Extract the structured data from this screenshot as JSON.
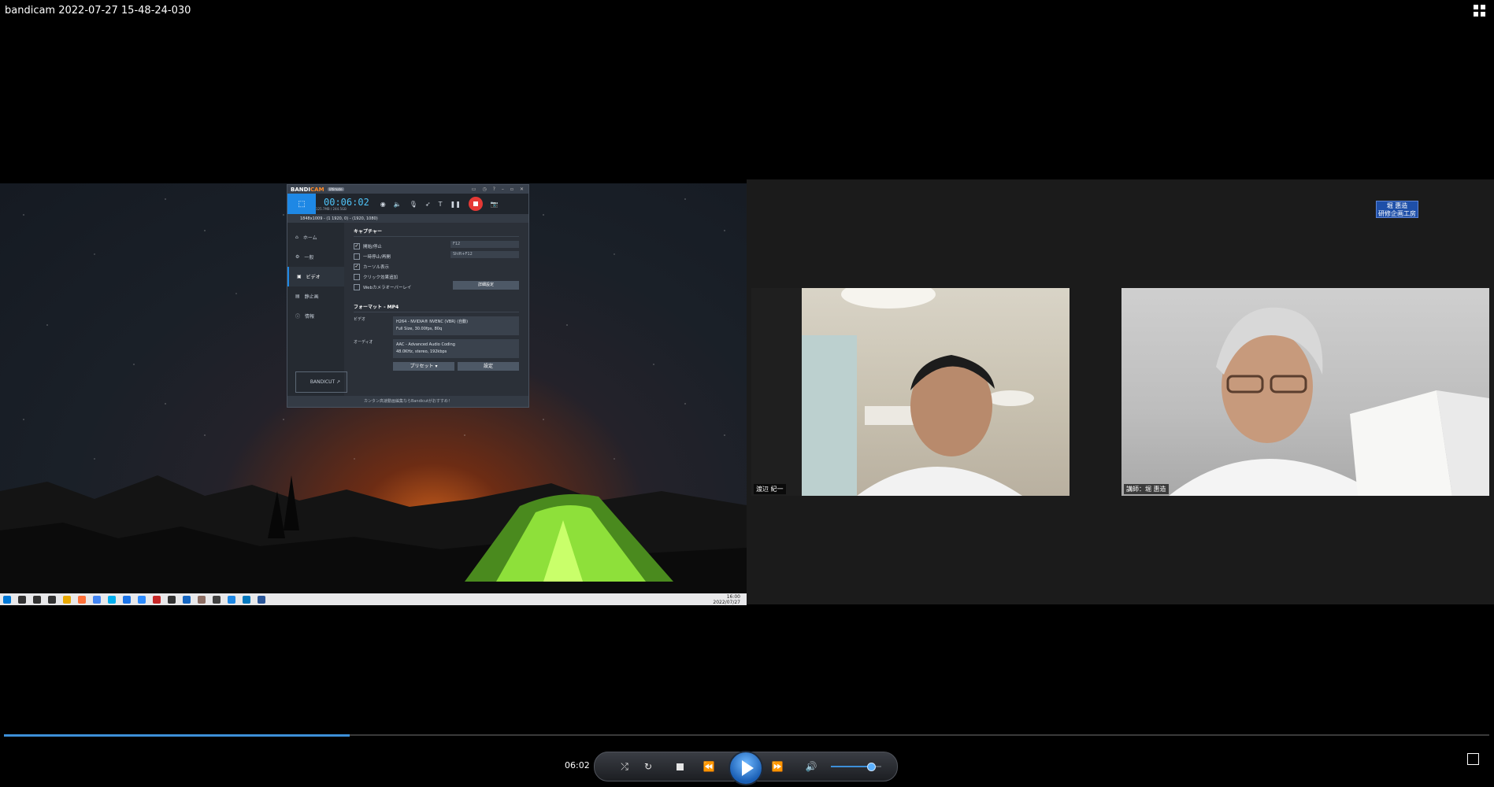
{
  "window": {
    "title": "bandicam 2022-07-27 15-48-24-030",
    "corner_icon": "switch-to-library-icon"
  },
  "desktop": {
    "taskbar_icons": [
      "windows-start",
      "search",
      "cortana",
      "task-view",
      "file-explorer",
      "firefox",
      "chrome",
      "skype",
      "edge",
      "zoom",
      "app",
      "media",
      "app",
      "app",
      "app",
      "app",
      "app",
      "word"
    ],
    "taskbar_icon_colors": [
      "#0078d7",
      "#333333",
      "#333333",
      "#333333",
      "#e8a800",
      "#ff7139",
      "#4285f4",
      "#00aff0",
      "#1a73e8",
      "#2d8cff",
      "#c62828",
      "#333333",
      "#1565c0",
      "#8d6e63",
      "#424242",
      "#1e88e5",
      "#0277bd",
      "#2b579a"
    ],
    "clock_time": "16:00",
    "clock_date": "2022/07/27"
  },
  "bandicam": {
    "logo_prefix": "BANDI",
    "logo_suffix": "CAM",
    "badge": "Ultimate",
    "timer": "00:06:02",
    "file_size": "125.7MB / 244.5GB",
    "target": "1848x1009 - (1 1920, 0) - (1920, 1080)",
    "sidebar": [
      {
        "label": "ホーム",
        "icon": "home-icon"
      },
      {
        "label": "一般",
        "icon": "gear-icon"
      },
      {
        "label": "ビデオ",
        "icon": "video-icon",
        "active": true
      },
      {
        "label": "静止画",
        "icon": "image-icon"
      },
      {
        "label": "情報",
        "icon": "info-icon"
      }
    ],
    "bandicut_label": "BANDICUT ↗",
    "capture_heading": "キャプチャー",
    "options": [
      {
        "label": "開始/停止",
        "checked": true
      },
      {
        "label": "一時停止/再開",
        "checked": false
      },
      {
        "label": "カーソル表示",
        "checked": true
      },
      {
        "label": "クリック効果追加",
        "checked": false
      },
      {
        "label": "Webカメラオーバーレイ",
        "checked": false
      }
    ],
    "hotkey_1": "F12",
    "hotkey_2": "Shift+F12",
    "advanced_button": "詳細設定",
    "format_heading": "フォーマット - MP4",
    "video_label": "ビデオ",
    "video_line1": "H264 - NVIDIA® NVENC (VBR) (自動)",
    "video_line2": "Full Size, 30.00fps, 80q",
    "audio_label": "オーディオ",
    "audio_line1": "AAC - Advanced Audio Coding",
    "audio_line2": "48.0KHz, stereo, 192kbps",
    "preset_button": "プリセット",
    "settings_button": "設定",
    "footer": "カンタン高速動画編集ならBandicutがおすすめ！"
  },
  "zoom": {
    "badge_line1": "堀 惠造",
    "badge_line2": "研修企画工房",
    "participant_left": "渡辺 紀一",
    "participant_right": "講師：堀 惠造"
  },
  "player": {
    "time": "06:02",
    "progress": 0.233,
    "volume": 0.78,
    "accent": "#3d8fd8"
  }
}
